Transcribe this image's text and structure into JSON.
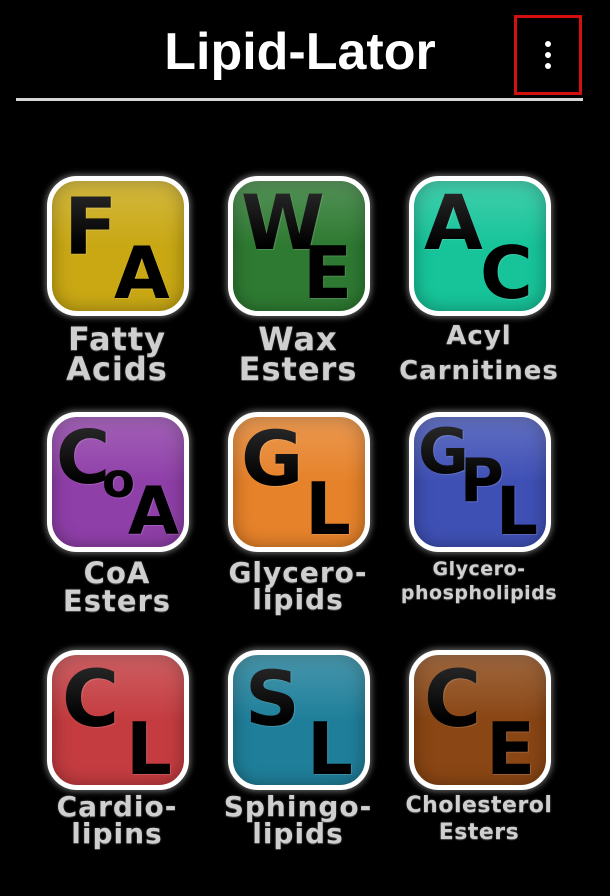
{
  "app_bar": {
    "title": "Lipid-Lator",
    "menu_icon": "more-vert-icon"
  },
  "tiles": [
    {
      "id": "fatty-acids",
      "letters": [
        "F",
        "A"
      ],
      "label": [
        "Fatty",
        "Acids"
      ],
      "color": "#c9a814"
    },
    {
      "id": "wax-esters",
      "letters": [
        "W",
        "E"
      ],
      "label": [
        "Wax",
        "Esters"
      ],
      "color": "#2e7a32"
    },
    {
      "id": "acyl-carnitines",
      "letters": [
        "A",
        "C"
      ],
      "label": [
        "Acyl",
        "Carnitines"
      ],
      "color": "#17c49a"
    },
    {
      "id": "coa-esters",
      "letters": [
        "C",
        "o",
        "A"
      ],
      "label": [
        "CoA",
        "Esters"
      ],
      "color": "#8f3fa8"
    },
    {
      "id": "glycerolipids",
      "letters": [
        "G",
        "L"
      ],
      "label": [
        "Glycero-",
        "lipids"
      ],
      "color": "#e6822a"
    },
    {
      "id": "glycerophospholipids",
      "letters": [
        "G",
        "P",
        "L"
      ],
      "label": [
        "Glycero-",
        "phospholipids"
      ],
      "color": "#3f50b5"
    },
    {
      "id": "cardiolipins",
      "letters": [
        "C",
        "L"
      ],
      "label": [
        "Cardio-",
        "lipins"
      ],
      "color": "#c43c40"
    },
    {
      "id": "sphingolipids",
      "letters": [
        "S",
        "L"
      ],
      "label": [
        "Sphingo-",
        "lipids"
      ],
      "color": "#1f7f9a"
    },
    {
      "id": "cholesterol-esters",
      "letters": [
        "C",
        "E"
      ],
      "label": [
        "Cholesterol",
        "Esters"
      ],
      "color": "#8a4614"
    }
  ]
}
